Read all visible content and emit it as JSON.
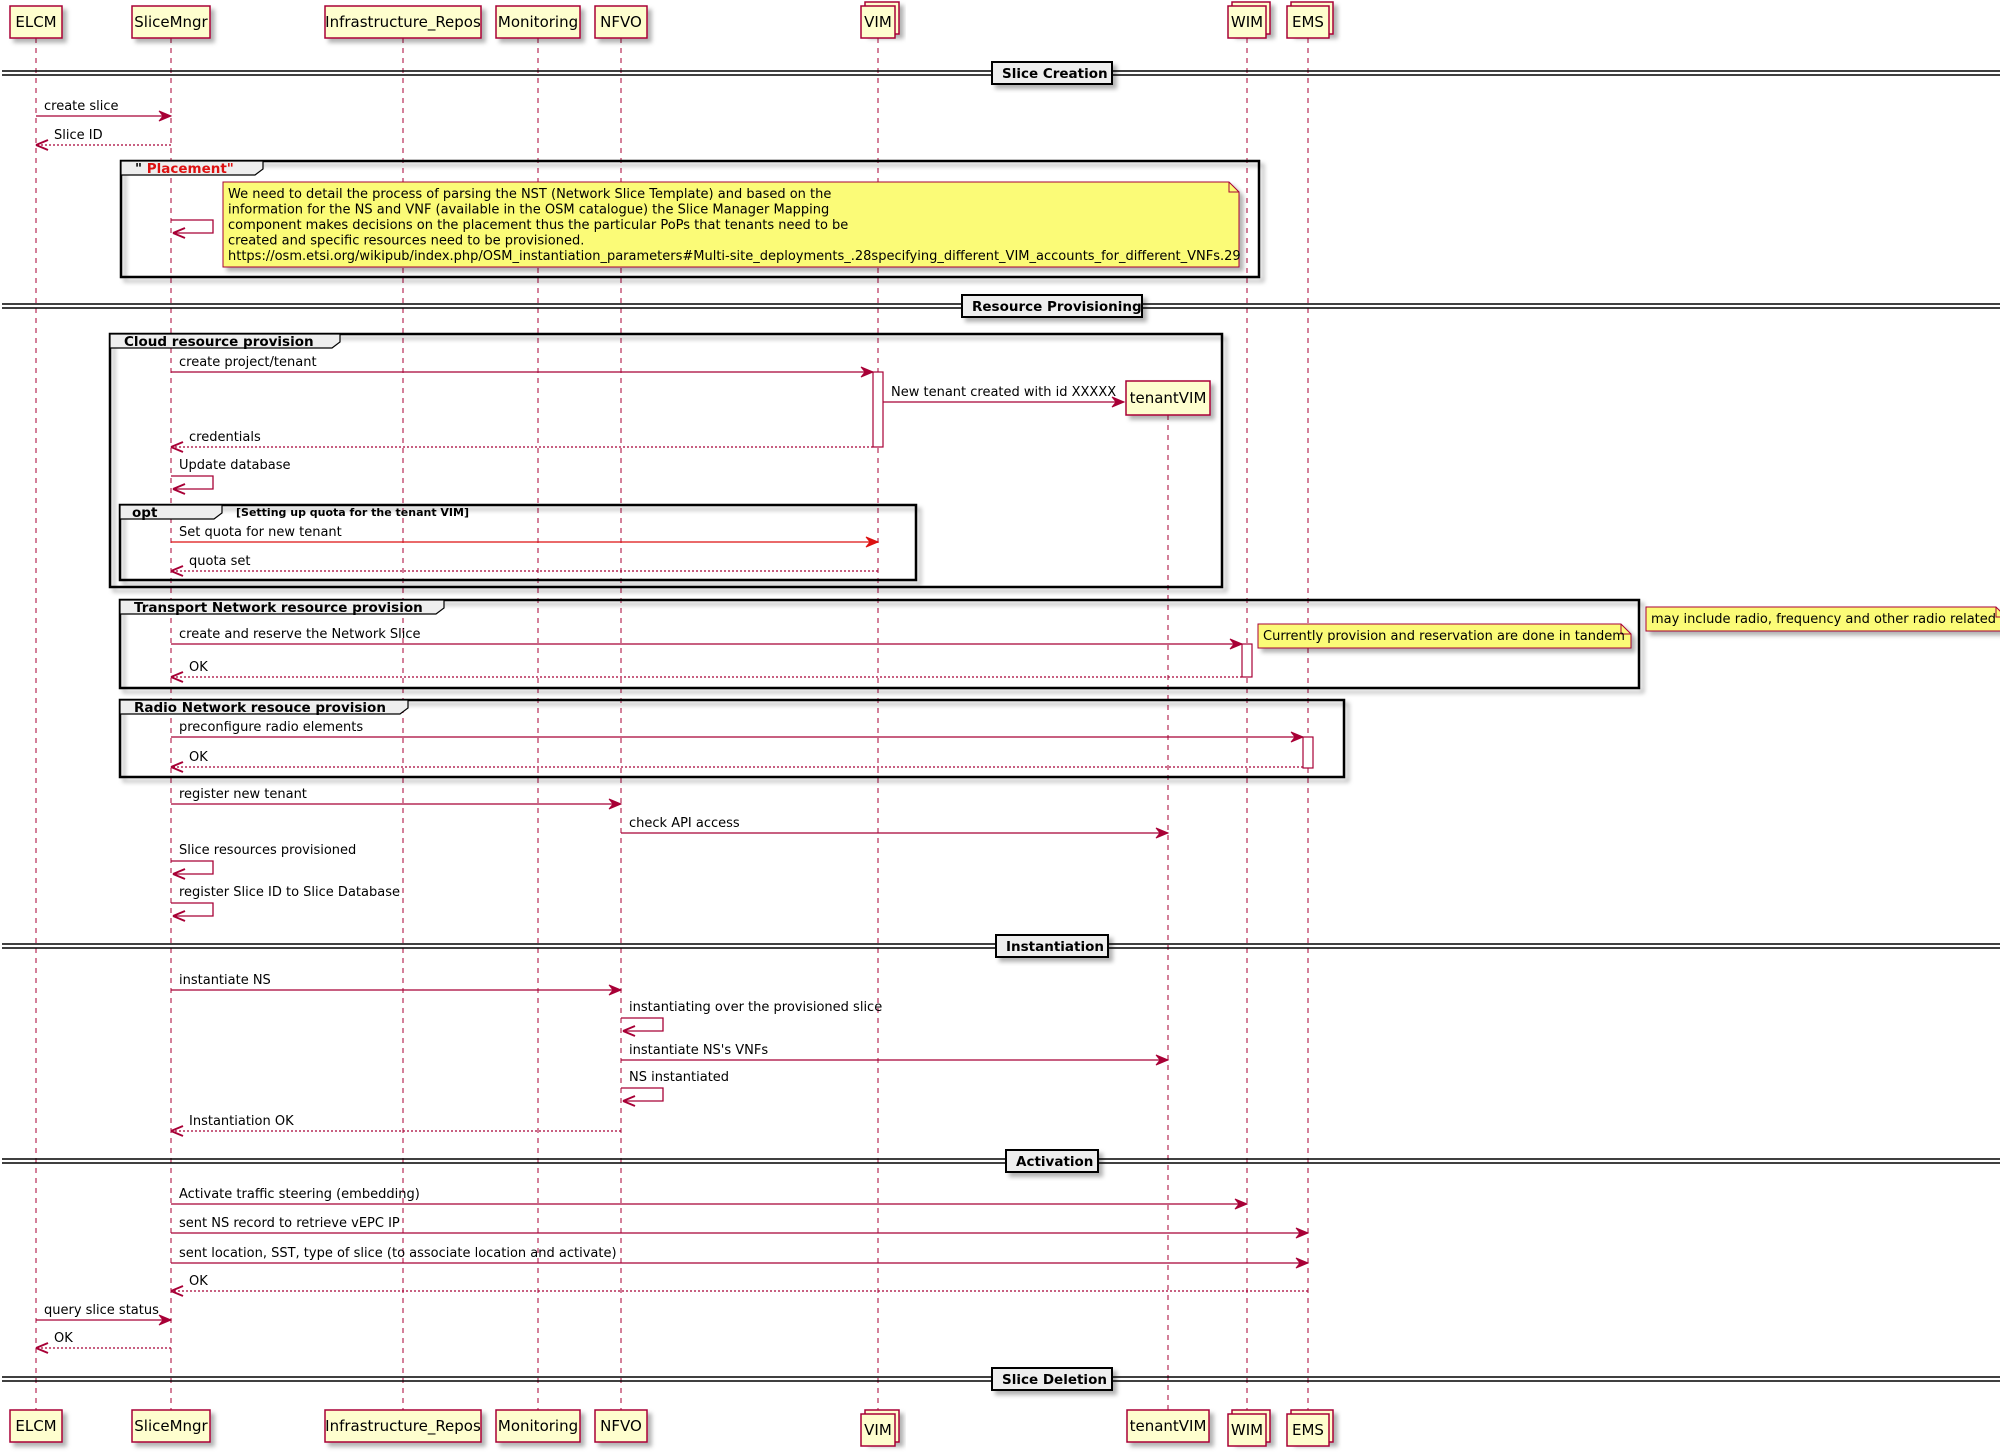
{
  "colors": {
    "arrow": "#A80036",
    "arrow_alt": "#DD1111",
    "participant_fill": "#FEFECE",
    "participant_border": "#A80036",
    "note_fill": "#FBFB77",
    "group_tab_fill": "#EEEEEE",
    "placement_title": "#DD1111"
  },
  "participants": [
    {
      "id": "ELCM",
      "label": "ELCM",
      "stacked": false
    },
    {
      "id": "SliceMngr",
      "label": "SliceMngr",
      "stacked": false
    },
    {
      "id": "Infrastructure_Repos",
      "label": "Infrastructure_Repos",
      "stacked": false
    },
    {
      "id": "Monitoring",
      "label": "Monitoring",
      "stacked": false
    },
    {
      "id": "NFVO",
      "label": "NFVO",
      "stacked": false
    },
    {
      "id": "VIM",
      "label": "VIM",
      "stacked": true
    },
    {
      "id": "tenantVIM",
      "label": "tenantVIM",
      "stacked": false,
      "created_mid": true
    },
    {
      "id": "WIM",
      "label": "WIM",
      "stacked": true
    },
    {
      "id": "EMS",
      "label": "EMS",
      "stacked": true
    }
  ],
  "dividers": [
    {
      "label": "Slice Creation"
    },
    {
      "label": "Resource Provisioning"
    },
    {
      "label": "Instantiation"
    },
    {
      "label": "Activation"
    },
    {
      "label": "Slice Deletion"
    }
  ],
  "groups": [
    {
      "title": "\" Placement\"",
      "condition": ""
    },
    {
      "title": "Cloud resource provision",
      "condition": ""
    },
    {
      "title": "opt",
      "condition": "[Setting up quota for the tenant VIM]"
    },
    {
      "title": "Transport Network resource provision",
      "condition": ""
    },
    {
      "title": "Radio Network resouce provision",
      "condition": ""
    }
  ],
  "notes": [
    {
      "lines": [
        "We need to detail the process of parsing the NST (Network Slice Template) and based on the",
        " information for the NS and VNF (available in the OSM catalogue) the Slice Manager Mapping",
        " component makes decisions on the placement thus the particular PoPs that tenants need to be",
        " created and specific resources need to be provisioned.",
        " https://osm.etsi.org/wikipub/index.php/OSM_instantiation_parameters#Multi-site_deployments_.28specifying_different_VIM_accounts_for_different_VNFs.29"
      ]
    },
    {
      "lines": [
        "Currently provision and reservation are done in tandem"
      ]
    },
    {
      "lines": [
        "may include radio, frequency and other radio related co"
      ]
    }
  ],
  "messages": [
    {
      "from": "ELCM",
      "to": "SliceMngr",
      "label": "create slice",
      "type": "sync"
    },
    {
      "from": "SliceMngr",
      "to": "ELCM",
      "label": "Slice ID",
      "type": "return"
    },
    {
      "from": "SliceMngr",
      "to": "SliceMngr",
      "label": "",
      "type": "self"
    },
    {
      "from": "SliceMngr",
      "to": "VIM",
      "label": "create project/tenant",
      "type": "sync"
    },
    {
      "from": "VIM",
      "to": "tenantVIM",
      "label": "New tenant created with id XXXXX",
      "type": "create"
    },
    {
      "from": "VIM",
      "to": "SliceMngr",
      "label": "credentials",
      "type": "return"
    },
    {
      "from": "SliceMngr",
      "to": "SliceMngr",
      "label": "Update database",
      "type": "self"
    },
    {
      "from": "SliceMngr",
      "to": "VIM",
      "label": "Set quota for new tenant",
      "type": "sync-alt"
    },
    {
      "from": "VIM",
      "to": "SliceMngr",
      "label": "quota set",
      "type": "return"
    },
    {
      "from": "SliceMngr",
      "to": "WIM",
      "label": "create and reserve the Network Slice",
      "type": "sync"
    },
    {
      "from": "WIM",
      "to": "SliceMngr",
      "label": "OK",
      "type": "return"
    },
    {
      "from": "SliceMngr",
      "to": "EMS",
      "label": "preconfigure radio elements",
      "type": "sync"
    },
    {
      "from": "EMS",
      "to": "SliceMngr",
      "label": "OK",
      "type": "return"
    },
    {
      "from": "SliceMngr",
      "to": "NFVO",
      "label": "register new tenant",
      "type": "sync"
    },
    {
      "from": "NFVO",
      "to": "tenantVIM",
      "label": "check API access",
      "type": "sync"
    },
    {
      "from": "SliceMngr",
      "to": "SliceMngr",
      "label": "Slice resources provisioned",
      "type": "self"
    },
    {
      "from": "SliceMngr",
      "to": "SliceMngr",
      "label": "register Slice ID to Slice Database",
      "type": "self"
    },
    {
      "from": "SliceMngr",
      "to": "NFVO",
      "label": "instantiate NS",
      "type": "sync"
    },
    {
      "from": "NFVO",
      "to": "NFVO",
      "label": "instantiating over the provisioned slice",
      "type": "self"
    },
    {
      "from": "NFVO",
      "to": "tenantVIM",
      "label": "instantiate NS's VNFs",
      "type": "sync"
    },
    {
      "from": "NFVO",
      "to": "NFVO",
      "label": "NS instantiated",
      "type": "self"
    },
    {
      "from": "NFVO",
      "to": "SliceMngr",
      "label": "Instantiation OK",
      "type": "return"
    },
    {
      "from": "SliceMngr",
      "to": "WIM",
      "label": "Activate traffic steering (embedding)",
      "type": "sync"
    },
    {
      "from": "SliceMngr",
      "to": "EMS",
      "label": "sent NS record to retrieve vEPC IP",
      "type": "sync"
    },
    {
      "from": "SliceMngr",
      "to": "EMS",
      "label": "sent location, SST, type of slice (to associate location and activate)",
      "type": "sync"
    },
    {
      "from": "EMS",
      "to": "SliceMngr",
      "label": "OK",
      "type": "return"
    },
    {
      "from": "ELCM",
      "to": "SliceMngr",
      "label": "query slice status",
      "type": "sync"
    },
    {
      "from": "SliceMngr",
      "to": "ELCM",
      "label": "OK",
      "type": "return"
    }
  ]
}
